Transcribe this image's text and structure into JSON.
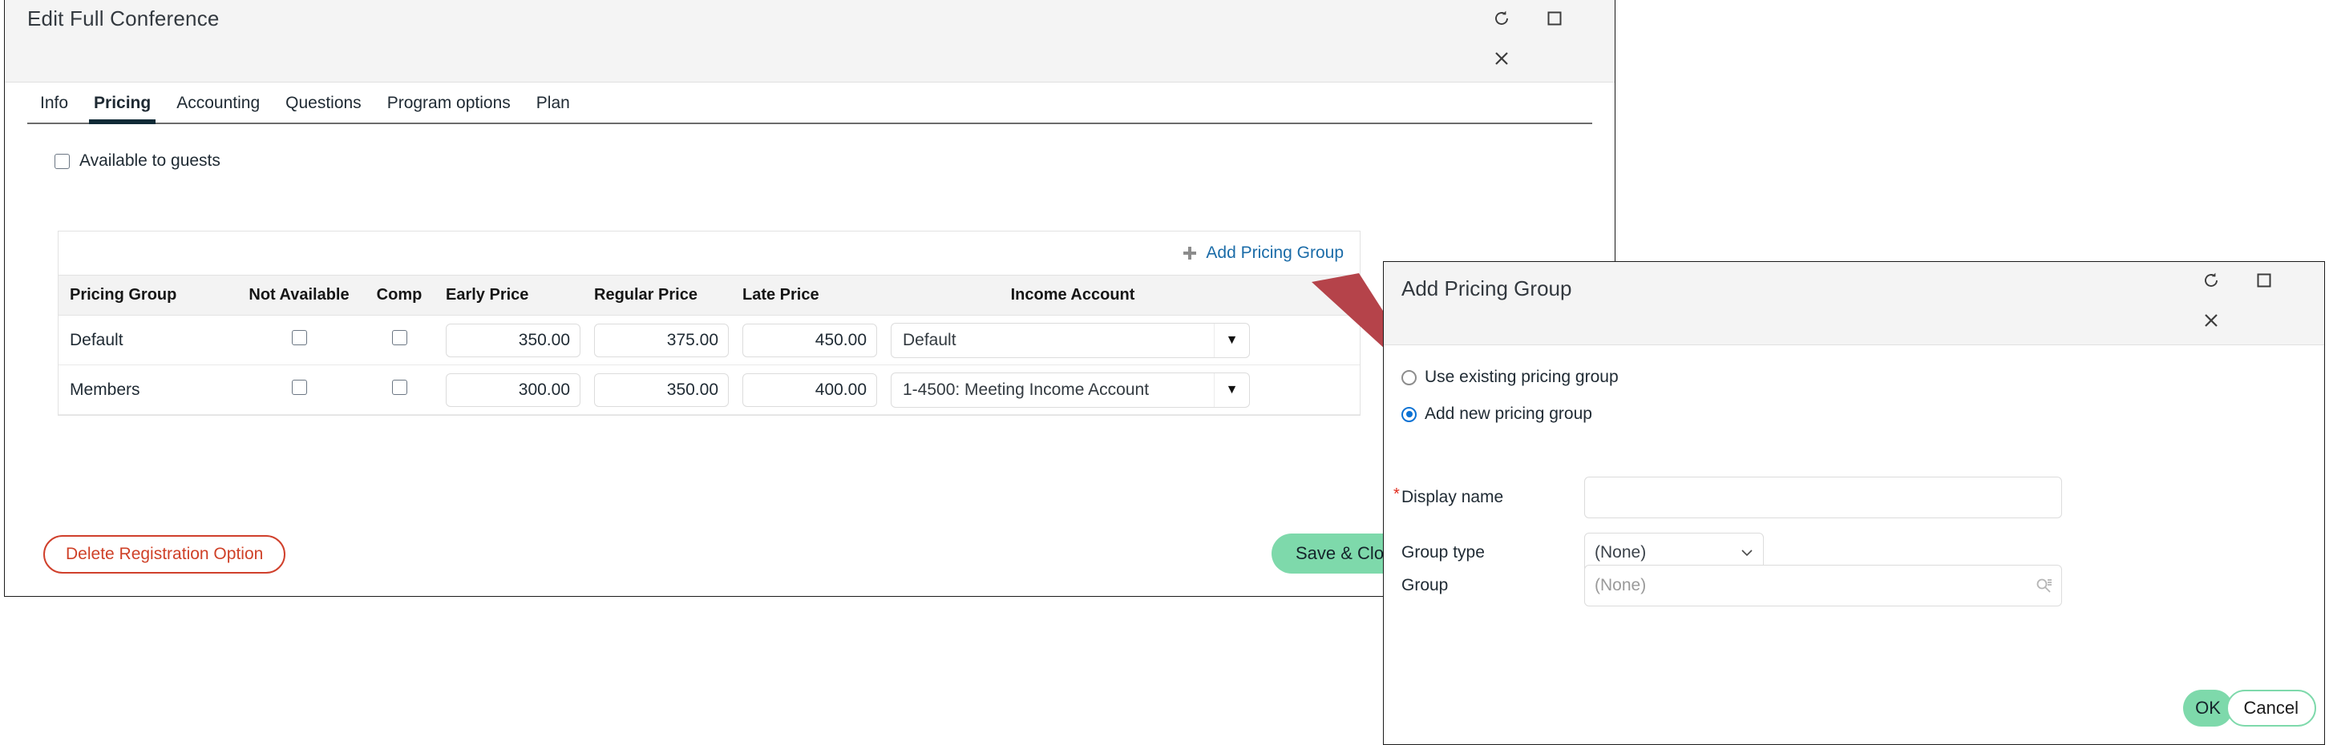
{
  "main_window": {
    "title": "Edit Full Conference",
    "controls": [
      {
        "name": "refresh-icon",
        "label": "Refresh"
      },
      {
        "name": "maximize-icon",
        "label": "Maximize"
      },
      {
        "name": "close-icon",
        "label": "Close"
      }
    ],
    "tabs": [
      {
        "label": "Info",
        "active": false
      },
      {
        "label": "Pricing",
        "active": true
      },
      {
        "label": "Accounting",
        "active": false
      },
      {
        "label": "Questions",
        "active": false
      },
      {
        "label": "Program options",
        "active": false
      },
      {
        "label": "Plan",
        "active": false
      }
    ],
    "available_to_guests": {
      "label": "Available to guests",
      "checked": false
    },
    "pricing_panel": {
      "add_link": "Add Pricing Group",
      "add_icon": "plus-icon",
      "columns": [
        "Pricing Group",
        "Not Available",
        "Comp",
        "Early Price",
        "Regular Price",
        "Late Price",
        "Income Account"
      ],
      "rows": [
        {
          "group": "Default",
          "not_available": false,
          "comp": false,
          "early_price": "350.00",
          "regular_price": "375.00",
          "late_price": "450.00",
          "income_account": "Default"
        },
        {
          "group": "Members",
          "not_available": false,
          "comp": false,
          "early_price": "300.00",
          "regular_price": "350.00",
          "late_price": "400.00",
          "income_account": "1-4500: Meeting Income Account"
        }
      ]
    },
    "delete_button": "Delete Registration Option",
    "save_button": "Save & Close"
  },
  "dialog": {
    "title": "Add Pricing Group",
    "controls": [
      {
        "name": "refresh-icon",
        "label": "Refresh"
      },
      {
        "name": "maximize-icon",
        "label": "Maximize"
      },
      {
        "name": "close-icon",
        "label": "Close"
      }
    ],
    "radios": [
      {
        "label": "Use existing pricing group",
        "checked": false
      },
      {
        "label": "Add new pricing group",
        "checked": true
      }
    ],
    "fields": {
      "display_name": {
        "label": "Display name",
        "required": true,
        "value": "",
        "placeholder": ""
      },
      "group_type": {
        "label": "Group type",
        "value": "(None)",
        "options": [
          "(None)"
        ]
      },
      "group": {
        "label": "Group",
        "value": "",
        "placeholder": "(None)",
        "icon": "search-icon"
      }
    },
    "ok_button": "OK",
    "cancel_button": "Cancel"
  },
  "annotation": {
    "type": "arrow",
    "color": "#b5434a",
    "points_to": "add-new-pricing-group-radio"
  },
  "colors": {
    "accent_link": "#1b6ca8",
    "primary_button": "#7ed9ab",
    "danger": "#cf4128",
    "radio_selected": "#0b72d4",
    "required_star": "#e02b1d",
    "annotation_arrow": "#b5434a",
    "header_bg": "#f4f4f4",
    "tab_active_underline": "#102a36"
  }
}
